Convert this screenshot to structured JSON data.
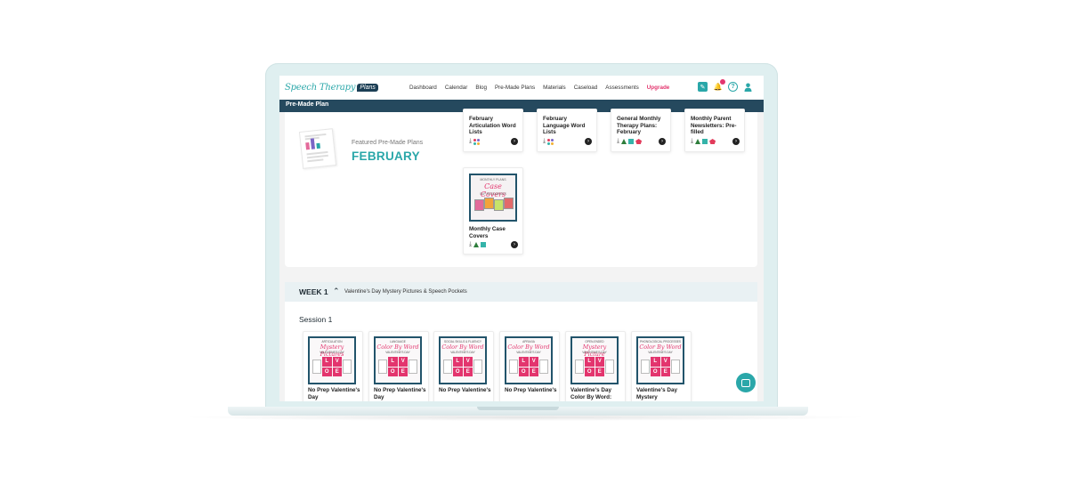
{
  "app": {
    "logo_text": "Speech Therapy",
    "logo_badge": "Plans"
  },
  "nav": {
    "items": [
      "Dashboard",
      "Calendar",
      "Blog",
      "Pre-Made Plans",
      "Materials",
      "Caseload",
      "Assessments"
    ],
    "upgrade": "Upgrade"
  },
  "header": {
    "icons": [
      "edit-icon",
      "bell-icon",
      "help-icon",
      "user-icon"
    ]
  },
  "page": {
    "title": "Pre-Made Plan"
  },
  "featured": {
    "label": "Featured Pre-Made Plans",
    "title": "FEBRUARY"
  },
  "cards": [
    {
      "title": "February Articulation Word Lists"
    },
    {
      "title": "February Language Word Lists"
    },
    {
      "title": "General Monthly Therapy Plans: February"
    },
    {
      "title": "Monthly Parent Newsletters: Pre-filled"
    },
    {
      "title": "Monthly Case Covers"
    }
  ],
  "case_cover": {
    "top": "MONTHLY PLANS",
    "main": "Case Covers",
    "sub": "SLP RESOURCES"
  },
  "week": {
    "label": "WEEK 1",
    "description": "Valentine's Day Mystery Pictures & Speech Pockets"
  },
  "session": {
    "label": "Session 1"
  },
  "materials": [
    {
      "cover_top": "ARTICULATION",
      "cover_main": "Mystery Pictures",
      "cover_sub": "VALENTINE'S DAY",
      "title": "No Prep Valentine's Day"
    },
    {
      "cover_top": "LANGUAGE",
      "cover_main": "Color By Word",
      "cover_sub": "VALENTINE'S DAY",
      "title": "No Prep Valentine's Day"
    },
    {
      "cover_top": "SOCIAL SKILLS & FLUENCY",
      "cover_main": "Color By Word",
      "cover_sub": "VALENTINE'S DAY",
      "title": "No Prep Valentine's"
    },
    {
      "cover_top": "APRAXIA",
      "cover_main": "Color By Word",
      "cover_sub": "VALENTINE'S DAY",
      "title": "No Prep Valentine's"
    },
    {
      "cover_top": "OPEN-ENDED",
      "cover_main": "Mystery Picture",
      "cover_sub": "VALENTINE'S DAY",
      "title": "Valentine's Day Color By Word:"
    },
    {
      "cover_top": "PHONOLOGICAL PROCESSES",
      "cover_main": "Color By Word",
      "cover_sub": "VALENTINE'S DAY",
      "title": "Valentine's Day Mystery"
    }
  ],
  "love_letters": [
    "L",
    "V",
    "O",
    "E"
  ],
  "colors": {
    "teal": "#2aa7a9",
    "navy": "#25495e",
    "pink": "#e3356e"
  }
}
